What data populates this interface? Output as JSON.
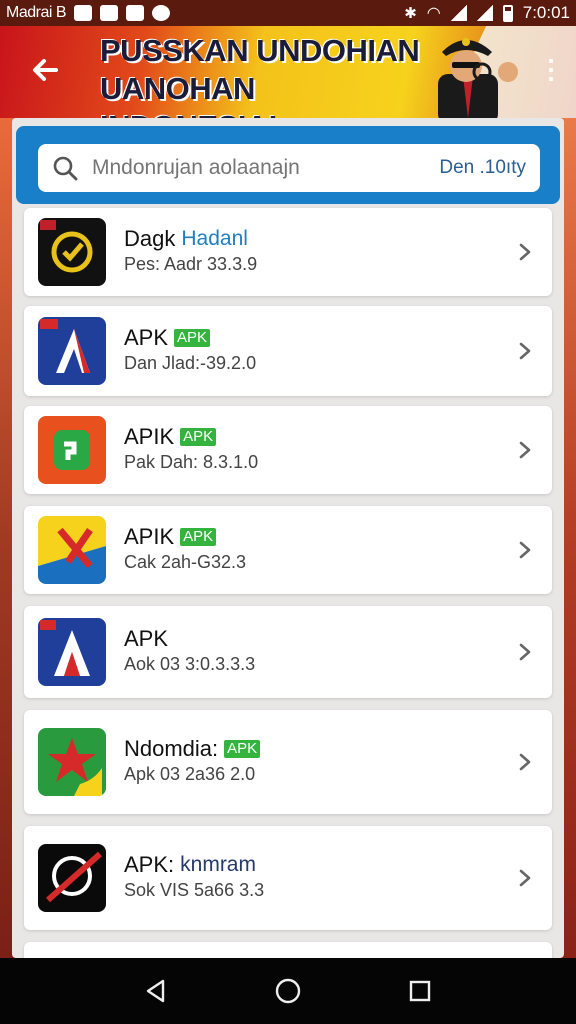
{
  "statusbar": {
    "carrier": "Madrai B",
    "time": "7:0:01"
  },
  "banner": {
    "line1": "PUSSKAN UNDOHIAN",
    "line2": "UANOHAN INDONESIA!"
  },
  "search": {
    "placeholder": "Mndonrujan aolaanajn",
    "filter": "Den .10ıty"
  },
  "apps": [
    {
      "name": "Dagk",
      "tag": "Hadanl",
      "tag_style": "blue",
      "meta": "Pes: Aadr 33.3.9",
      "icon": "gauge-icon",
      "colors": [
        "#111111",
        "#e8c21a",
        "#c0202a"
      ]
    },
    {
      "name": "APK",
      "tag": "APK",
      "tag_style": "green",
      "meta": "Dan Jlad:-39.2.0",
      "icon": "a-logo-icon",
      "colors": [
        "#1f3f9a",
        "#d62a2a",
        "#ffffff"
      ]
    },
    {
      "name": "APIK",
      "tag": "APK",
      "tag_style": "green",
      "meta": "Pak Dah: 8.3.1.0",
      "icon": "phone-chat-icon",
      "colors": [
        "#e8501e",
        "#2aa845",
        "#ffffff"
      ]
    },
    {
      "name": "APIK",
      "tag": "APK",
      "tag_style": "green",
      "meta": "Cak 2ah-G32.3",
      "icon": "x-mark-icon",
      "colors": [
        "#f6d21c",
        "#d62a2a",
        "#1a6fbf"
      ]
    },
    {
      "name": "APK",
      "tag": "",
      "tag_style": "none",
      "meta": "Aok 03 3:0.3.3.3",
      "icon": "a-triangle-icon",
      "colors": [
        "#1f3f9a",
        "#d62a2a",
        "#ffffff"
      ]
    },
    {
      "name": "Ndomdia:",
      "tag": "APK",
      "tag_style": "green",
      "meta": "Apk 03 2a36 2.0",
      "icon": "star-swoosh-icon",
      "colors": [
        "#2a9a3e",
        "#d62a2a",
        "#f6d21c"
      ]
    },
    {
      "name": "APK:",
      "tag": "knmram",
      "tag_style": "navy",
      "meta": "Sok VIS 5a66 3.3",
      "icon": "no-entry-icon",
      "colors": [
        "#0a0a0a",
        "#d62a2a",
        "#ffffff"
      ]
    }
  ]
}
